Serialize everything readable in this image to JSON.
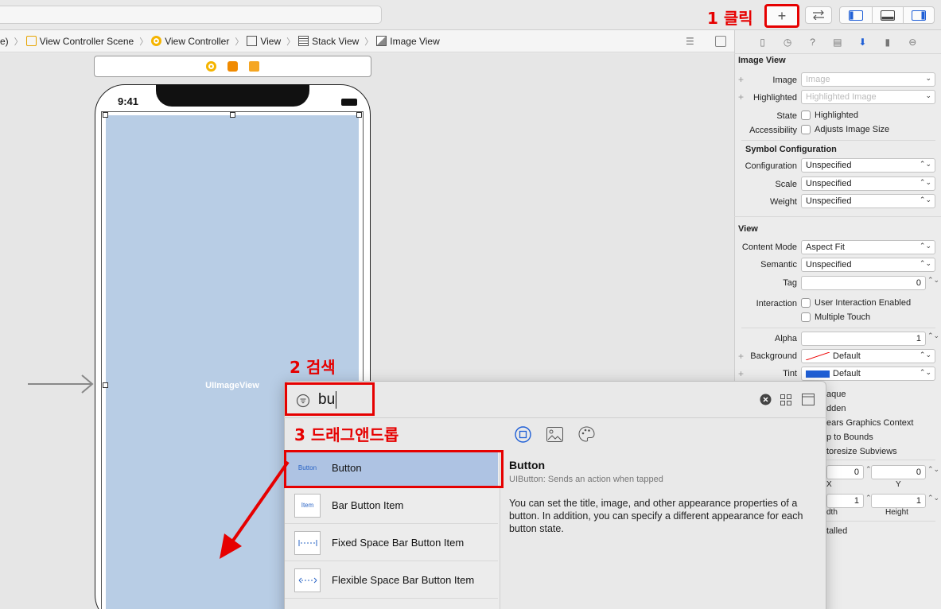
{
  "annotations": {
    "step1": "1 클릭",
    "step2": "2 검색",
    "step3": "3 드래그앤드롭"
  },
  "toolbar": {
    "library_button_icon": "plus-icon",
    "library_button_label": "+",
    "code_review_icon": "arrows-left-right-icon"
  },
  "jumpbar": {
    "crumbs": [
      {
        "label": "e)"
      },
      {
        "label": "View Controller Scene",
        "icon": "scene-icon"
      },
      {
        "label": "View Controller",
        "icon": "view-controller-icon"
      },
      {
        "label": "View",
        "icon": "view-icon"
      },
      {
        "label": "Stack View",
        "icon": "stack-view-icon"
      },
      {
        "label": "Image View",
        "icon": "image-view-icon"
      }
    ]
  },
  "canvas": {
    "status_time": "9:41",
    "image_view_label": "UIImageView"
  },
  "inspector": {
    "image_view_title": "Image View",
    "image_label": "Image",
    "image_placeholder": "Image",
    "highlighted_label": "Highlighted",
    "highlighted_placeholder": "Highlighted Image",
    "state_label": "State",
    "state_check": "Highlighted",
    "accessibility_label": "Accessibility",
    "accessibility_check": "Adjusts Image Size",
    "symbol_title": "Symbol Configuration",
    "configuration_label": "Configuration",
    "configuration_value": "Unspecified",
    "scale_label": "Scale",
    "scale_value": "Unspecified",
    "weight_label": "Weight",
    "weight_value": "Unspecified",
    "view_title": "View",
    "content_mode_label": "Content Mode",
    "content_mode_value": "Aspect Fit",
    "semantic_label": "Semantic",
    "semantic_value": "Unspecified",
    "tag_label": "Tag",
    "tag_value": "0",
    "interaction_label": "Interaction",
    "interaction_check1": "User Interaction Enabled",
    "interaction_check2": "Multiple Touch",
    "alpha_label": "Alpha",
    "alpha_value": "1",
    "background_label": "Background",
    "background_value": "Default",
    "tint_label": "Tint",
    "tint_value": "Default",
    "partial_opaque": "aque",
    "partial_hidden": "dden",
    "partial_clears": "ears Graphics Context",
    "partial_clip": "p to Bounds",
    "partial_autoresize": "toresize Subviews",
    "x_value": "0",
    "y_value": "0",
    "x_label": "X",
    "y_label": "Y",
    "width_value": "1",
    "height_value": "1",
    "width_label": "dth",
    "height_label": "Height",
    "installed_partial": "talled"
  },
  "library": {
    "search_value": "bu",
    "items": [
      {
        "name": "Button",
        "thumb": "Button",
        "selected": true
      },
      {
        "name": "Bar Button Item",
        "thumb": "Item"
      },
      {
        "name": "Fixed Space Bar Button Item",
        "thumb": "fixed-space-icon"
      },
      {
        "name": "Flexible Space Bar Button Item",
        "thumb": "flexible-space-icon"
      }
    ],
    "detail_title": "Button",
    "detail_subtitle": "UIButton: Sends an action when tapped",
    "detail_body": "You can set the title, image, and other appearance properties of a button. In addition, you can specify a different appearance for each button state."
  },
  "colors": {
    "annotation_red": "#e60000",
    "selection_blue": "#aec3e3",
    "image_view_fill": "#b8cde5",
    "tint_blue": "#1f5fd6"
  }
}
